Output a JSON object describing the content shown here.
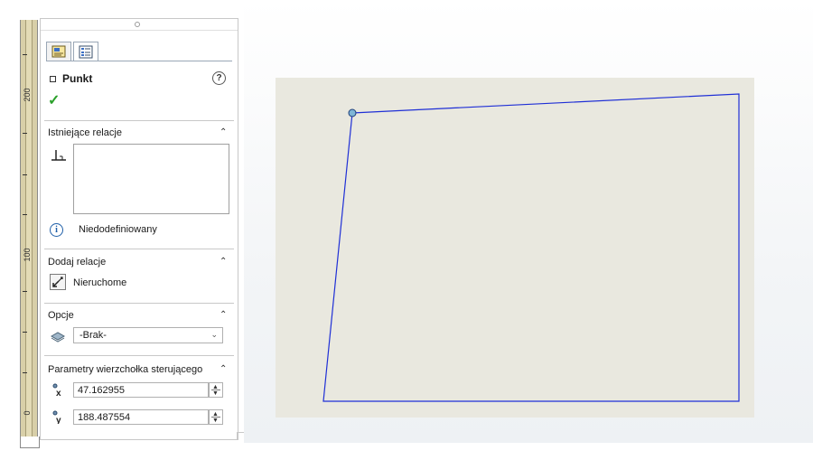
{
  "ruler": {
    "labels": [
      "200",
      "100",
      "0"
    ]
  },
  "panel": {
    "title": "Punkt",
    "help_icon": "?",
    "tabs": [
      {
        "name": "property-manager-tab",
        "icon": "property-manager-icon"
      },
      {
        "name": "feature-tree-tab",
        "icon": "list-icon"
      }
    ],
    "sections": {
      "existing_relations": {
        "title": "Istniejące relacje",
        "status": "Niedodefiniowany"
      },
      "add_relations": {
        "title": "Dodaj relacje",
        "item": "Nieruchome"
      },
      "options": {
        "title": "Opcje",
        "selected": "-Brak-"
      },
      "vertex_params": {
        "title": "Parametry wierzchołka sterującego",
        "x_value": "47.162955",
        "y_value": "188.487554"
      }
    }
  },
  "colors": {
    "sketch_line": "#1f2fd6",
    "sheet_background": "#e9e8df",
    "check_green": "#2aa02a",
    "info_blue": "#1f5fa8"
  }
}
